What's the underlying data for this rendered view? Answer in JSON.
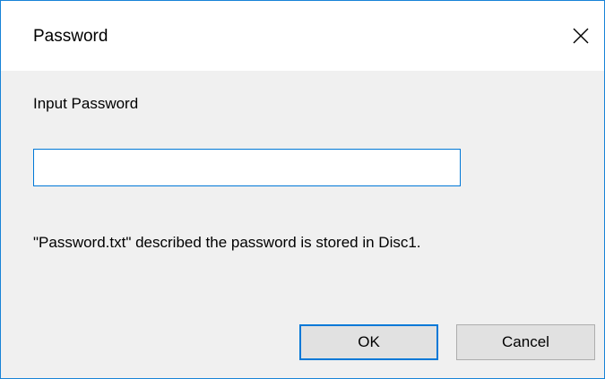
{
  "window": {
    "title": "Password",
    "close_symbol": "✕"
  },
  "prompt": {
    "label": "Input Password"
  },
  "password_field": {
    "value": "",
    "placeholder": ""
  },
  "hint": {
    "text": "\"Password.txt\" described the password is stored in Disc1."
  },
  "buttons": {
    "ok_label": "OK",
    "cancel_label": "Cancel"
  },
  "colors": {
    "accent": "#0078d7",
    "window_border": "#1883d7",
    "dialog_background": "#f0f0f0",
    "button_background": "#e1e1e1"
  },
  "icons": {
    "close": "close-icon"
  }
}
